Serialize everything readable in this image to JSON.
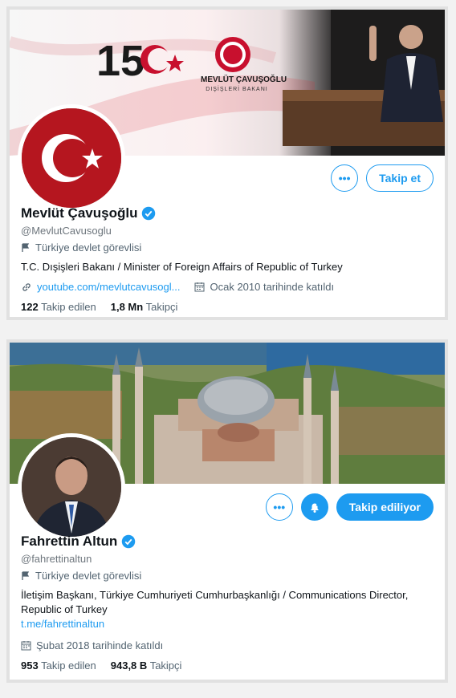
{
  "profiles": [
    {
      "banner": {
        "anniversary_number": "15",
        "ministry_title": "MEVLÜT ÇAVUŞOĞLU",
        "ministry_subtitle": "DIŞİŞLERİ BAKANI"
      },
      "name": "Mevlüt Çavuşoğlu",
      "handle": "@MevlutCavusoglu",
      "category": "Türkiye devlet görevlisi",
      "bio": "T.C. Dışişleri Bakanı / Minister of Foreign Affairs of Republic of Turkey",
      "link": "youtube.com/mevlutcavusogl...",
      "joined": "Ocak 2010 tarihinde katıldı",
      "following_count": "122",
      "following_label": "Takip edilen",
      "followers_count": "1,8 Mn",
      "followers_label": "Takipçi",
      "follow_button": "Takip et"
    },
    {
      "name": "Fahrettin Altun",
      "handle": "@fahrettinaltun",
      "category": "Türkiye devlet görevlisi",
      "bio": "İletişim Başkanı, Türkiye Cumhuriyeti Cumhurbaşkanlığı / Communications Director, Republic of Turkey",
      "link": "t.me/fahrettinaltun",
      "joined": "Şubat 2018 tarihinde katıldı",
      "following_count": "953",
      "following_label": "Takip edilen",
      "followers_count": "943,8 B",
      "followers_label": "Takipçi",
      "follow_button": "Takip ediliyor"
    }
  ],
  "icons": {
    "more": "more-icon",
    "verified": "verified-badge-icon",
    "category": "flag-icon",
    "link": "link-icon",
    "calendar": "calendar-icon",
    "notifications": "bell-icon"
  },
  "colors": {
    "accent": "#1d9bf0",
    "text": "#0f1419",
    "muted": "#536471",
    "flag_red": "#c8102e"
  }
}
